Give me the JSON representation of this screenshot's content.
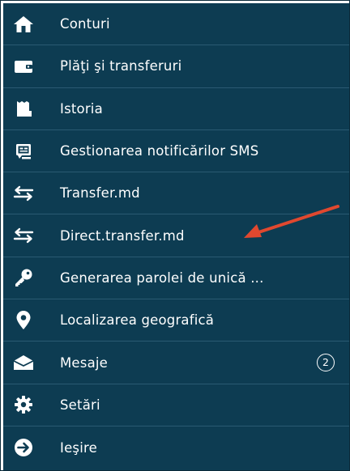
{
  "menu": {
    "items": [
      {
        "label": "Conturi",
        "icon": "home-icon"
      },
      {
        "label": "Plăţi şi transferuri",
        "icon": "wallet-icon"
      },
      {
        "label": "Istoria",
        "icon": "receipt-icon"
      },
      {
        "label": "Gestionarea notificărilor SMS",
        "icon": "sms-notification-icon"
      },
      {
        "label": "Transfer.md",
        "icon": "transfer-arrows-icon"
      },
      {
        "label": "Direct.transfer.md",
        "icon": "transfer-arrows-icon"
      },
      {
        "label": "Generarea parolei de unică ...",
        "icon": "key-icon"
      },
      {
        "label": "Localizarea geografică",
        "icon": "location-pin-icon"
      },
      {
        "label": "Mesaje",
        "icon": "envelope-icon",
        "badge": "2"
      },
      {
        "label": "Setări",
        "icon": "gear-icon"
      },
      {
        "label": "Ieşire",
        "icon": "exit-arrow-icon"
      }
    ]
  },
  "annotation": {
    "color": "#e0482f",
    "icon": "red-arrow-annotation"
  },
  "colors": {
    "menu_background": "#0d3c52",
    "divider": "#2a5a72",
    "text": "#ffffff"
  }
}
